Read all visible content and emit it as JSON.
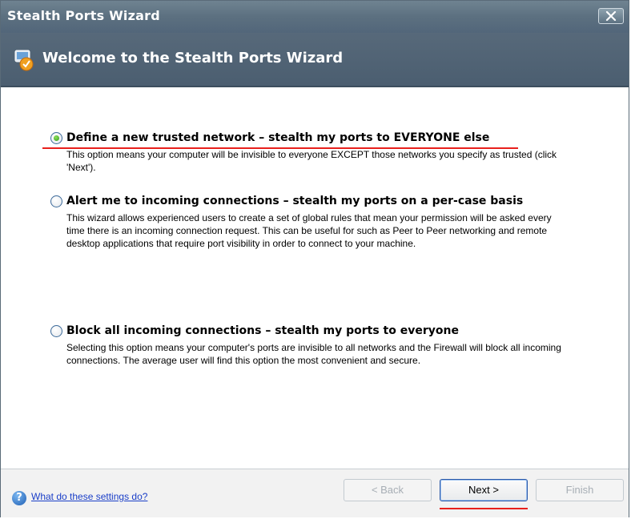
{
  "window": {
    "title": "Stealth Ports Wizard",
    "close_label": "✕"
  },
  "header": {
    "title": "Welcome to the Stealth Ports Wizard",
    "icon": "wizard-shield-icon"
  },
  "options": [
    {
      "label": "Define a new trusted network – stealth my ports to EVERYONE else",
      "description": "This option means your computer will be invisible to everyone EXCEPT those networks you specify as trusted (click 'Next').",
      "selected": true
    },
    {
      "label": "Alert me to incoming connections – stealth my ports on a per-case basis",
      "description": "This wizard allows experienced users to create a set of global rules that mean your permission will be asked every time there is an incoming connection request. This can be useful for such as Peer to Peer networking and remote desktop applications that require port visibility in order to connect to your machine.",
      "selected": false
    },
    {
      "label": "Block all incoming connections – stealth my ports to everyone",
      "description": "Selecting this option means your computer's ports are invisible to all networks and the Firewall will block all incoming connections. The average user will find this option the most convenient and secure.",
      "selected": false
    }
  ],
  "footer": {
    "help_link": "What do these settings do?",
    "help_icon": "question-icon",
    "back_label": "< Back",
    "next_label": "Next >",
    "finish_label": "Finish"
  },
  "colors": {
    "titlebar": "#5c7080",
    "header_band": "#4b5e70",
    "highlight_red": "#e8201c",
    "link": "#1a3ec8"
  }
}
